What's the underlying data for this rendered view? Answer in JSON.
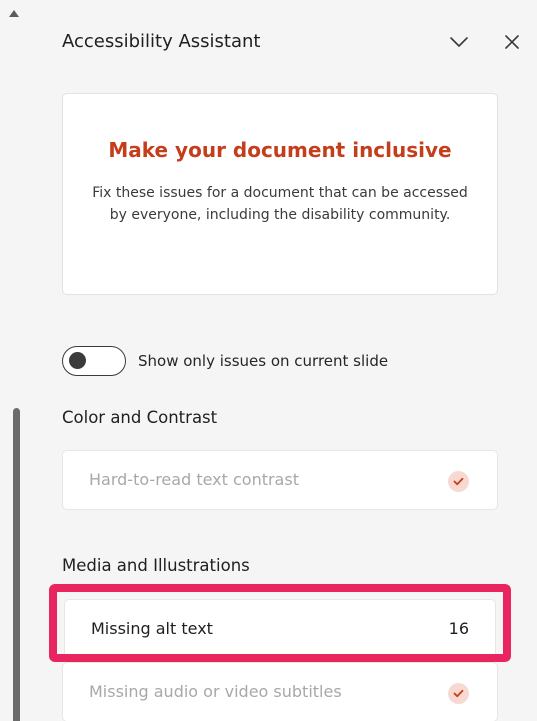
{
  "pane": {
    "title": "Accessibility Assistant",
    "icons": {
      "collapse": "chevron-down-icon",
      "close": "close-icon"
    }
  },
  "intro": {
    "headline": "Make your document inclusive",
    "body": "Fix these issues for a document that can be accessed by everyone, including the disability community."
  },
  "toggle": {
    "label": "Show only issues on current slide",
    "on": false
  },
  "sections": [
    {
      "title": "Color and Contrast",
      "issues": [
        {
          "label": "Hard-to-read text contrast",
          "status": "resolved"
        }
      ]
    },
    {
      "title": "Media and Illustrations",
      "issues": [
        {
          "label": "Missing alt text",
          "count": "16",
          "status": "open"
        },
        {
          "label": "Missing audio or video subtitles",
          "status": "resolved"
        }
      ]
    }
  ],
  "colors": {
    "accent_headline": "#c43e1c",
    "highlight": "#e8255e",
    "check_bg": "#f7d9d2",
    "check_mark": "#c43e1c"
  }
}
